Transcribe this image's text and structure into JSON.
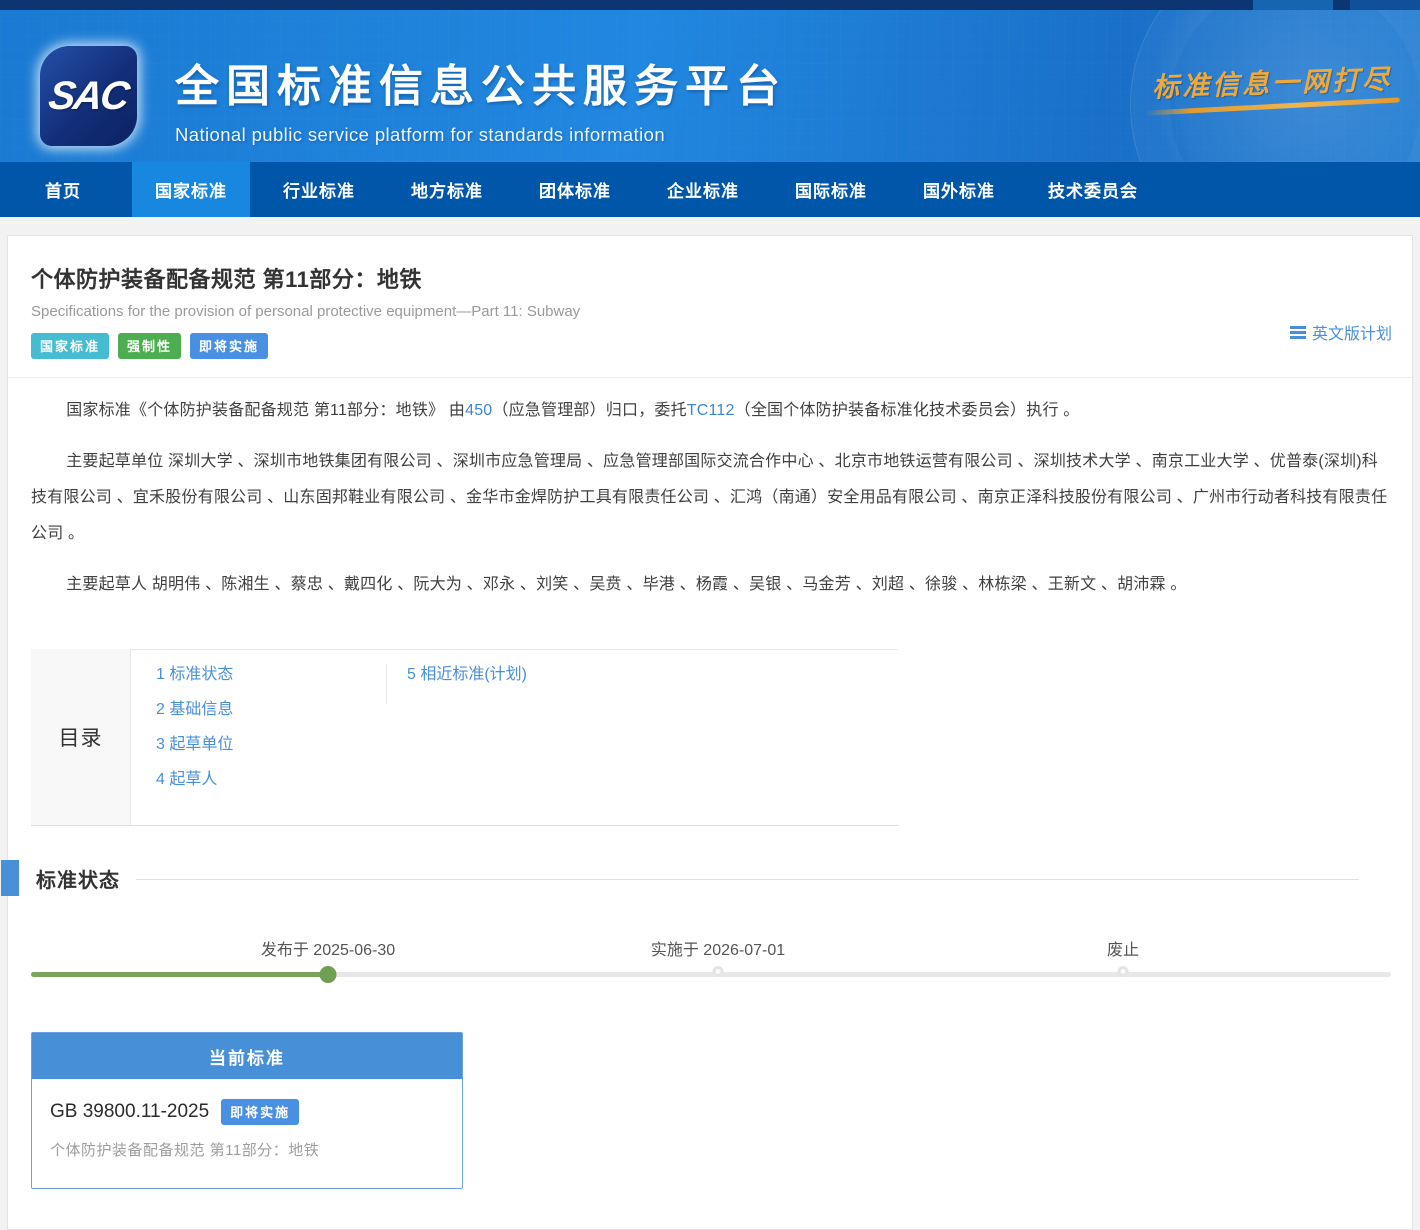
{
  "colors": {
    "header_blue": "#1f7fd8",
    "nav_blue": "#0056a8",
    "nav_active_blue": "#1787e0",
    "accent_blue": "#4a90d9",
    "badge_teal": "#45bcd2",
    "badge_green": "#4cae50",
    "badge_blue": "#4a90e2",
    "timeline_green": "#6f9f53",
    "slogan_gold": "#eda93d"
  },
  "header": {
    "logo_text": "SAC",
    "title": "全国标准信息公共服务平台",
    "subtitle": "National public service platform for standards information",
    "slogan": "标准信息一网打尽"
  },
  "nav": {
    "items": [
      {
        "label": "首页",
        "active": false
      },
      {
        "label": "国家标准",
        "active": true
      },
      {
        "label": "行业标准",
        "active": false
      },
      {
        "label": "地方标准",
        "active": false
      },
      {
        "label": "团体标准",
        "active": false
      },
      {
        "label": "企业标准",
        "active": false
      },
      {
        "label": "国际标准",
        "active": false
      },
      {
        "label": "国外标准",
        "active": false
      },
      {
        "label": "技术委员会",
        "active": false
      }
    ]
  },
  "page": {
    "title": "个体防护装备配备规范 第11部分：地铁",
    "subtitle_en": "Specifications for the provision of personal protective equipment—Part 11: Subway",
    "badges": [
      {
        "label": "国家标准",
        "color": "#45bcd2"
      },
      {
        "label": "强制性",
        "color": "#4cae50"
      },
      {
        "label": "即将实施",
        "color": "#4a90e2"
      }
    ],
    "english_plan_label": "英文版计划"
  },
  "intro": {
    "p1_part1": "国家标准《个体防护装备配备规范 第11部分：地铁》 由",
    "p1_link1": "450",
    "p1_part2": "（应急管理部）归口，委托",
    "p1_link2": "TC112",
    "p1_part3": "（全国个体防护装备标准化技术委员会）执行 。",
    "p2": "主要起草单位 深圳大学 、深圳市地铁集团有限公司 、深圳市应急管理局 、应急管理部国际交流合作中心 、北京市地铁运营有限公司 、深圳技术大学 、南京工业大学 、优普泰(深圳)科技有限公司 、宜禾股份有限公司 、山东固邦鞋业有限公司 、金华市金焊防护工具有限责任公司 、汇鸿（南通）安全用品有限公司 、南京正泽科技股份有限公司 、广州市行动者科技有限责任公司 。",
    "p3": "主要起草人 胡明伟 、陈湘生 、蔡忠 、戴四化 、阮大为 、邓永 、刘笑 、吴贲 、毕港 、杨霞 、吴银 、马金芳 、刘超 、徐骏 、林栋梁 、王新文 、胡沛霖 。"
  },
  "toc": {
    "label": "目录",
    "col1": [
      "1 标准状态",
      "2 基础信息",
      "3 起草单位",
      "4 起草人"
    ],
    "col2": [
      "5 相近标准(计划)"
    ]
  },
  "status_section": {
    "title": "标准状态",
    "milestones": [
      {
        "label": "发布于 2025-06-30",
        "state": "done"
      },
      {
        "label": "实施于 2026-07-01",
        "state": "pending"
      },
      {
        "label": "废止",
        "state": "pending"
      }
    ]
  },
  "current_standard": {
    "header": "当前标准",
    "code": "GB 39800.11-2025",
    "badge": "即将实施",
    "name": "个体防护装备配备规范 第11部分：地铁"
  }
}
